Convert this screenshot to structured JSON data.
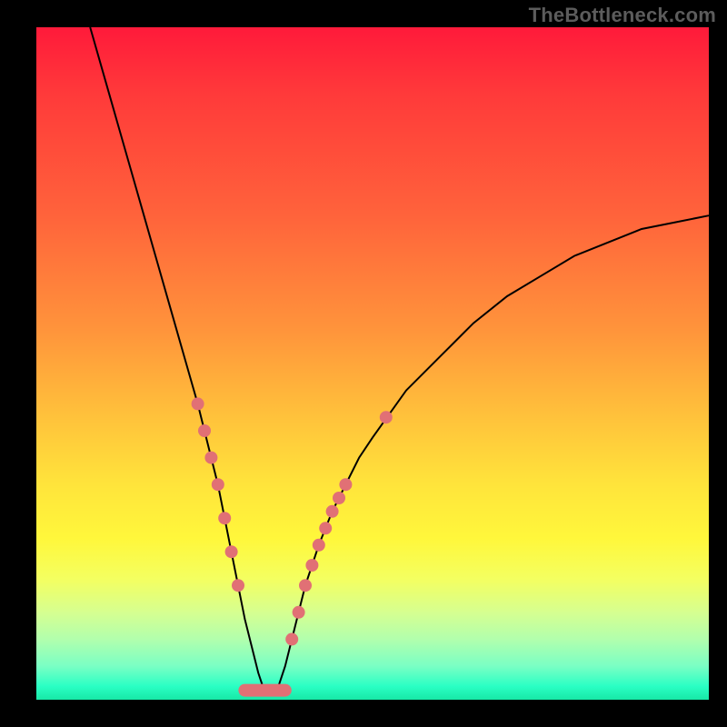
{
  "watermark": "TheBottleneck.com",
  "colors": {
    "background": "#000000",
    "curve": "#000000",
    "marker": "#e17075",
    "gradient_top": "#ff1a3a",
    "gradient_bottom": "#17e8a6"
  },
  "chart_data": {
    "type": "line",
    "title": "",
    "xlabel": "",
    "ylabel": "",
    "x_range": [
      0,
      100
    ],
    "y_range": [
      0,
      100
    ],
    "note": "Axes unlabeled in original image; values are normalized 0–100. y=0 is the green bottom (optimum), y=100 is the red top. The curve is a V-shaped bottleneck profile with its minimum around x≈34.",
    "series": [
      {
        "name": "bottleneck-curve",
        "x": [
          8,
          10,
          12,
          14,
          16,
          18,
          20,
          22,
          24,
          25,
          26,
          27,
          28,
          29,
          30,
          31,
          32,
          33,
          34,
          35,
          36,
          37,
          38,
          39,
          40,
          42,
          44,
          46,
          48,
          50,
          55,
          60,
          65,
          70,
          75,
          80,
          85,
          90,
          95,
          100
        ],
        "y": [
          100,
          93,
          86,
          79,
          72,
          65,
          58,
          51,
          44,
          40,
          36,
          32,
          27,
          22,
          17,
          12,
          8,
          4,
          1,
          1,
          2,
          5,
          9,
          13,
          17,
          23,
          28,
          32,
          36,
          39,
          46,
          51,
          56,
          60,
          63,
          66,
          68,
          70,
          71,
          72
        ]
      }
    ],
    "markers": {
      "name": "highlighted-points",
      "comment": "Pink dot clusters along ascending slopes near the vertex, plus a thick pink segment along the very bottom.",
      "left_cluster_x": [
        24,
        25,
        26,
        27,
        28,
        29,
        30
      ],
      "left_cluster_y": [
        44,
        40,
        36,
        32,
        27,
        22,
        17
      ],
      "right_cluster_x": [
        38,
        39,
        40,
        41,
        42,
        43,
        44,
        45,
        46,
        52
      ],
      "right_cluster_y": [
        9,
        13,
        17,
        20,
        23,
        25.5,
        28,
        30,
        32,
        42
      ],
      "bottom_segment_x": [
        31,
        37
      ],
      "bottom_segment_y": [
        1,
        1
      ]
    }
  }
}
